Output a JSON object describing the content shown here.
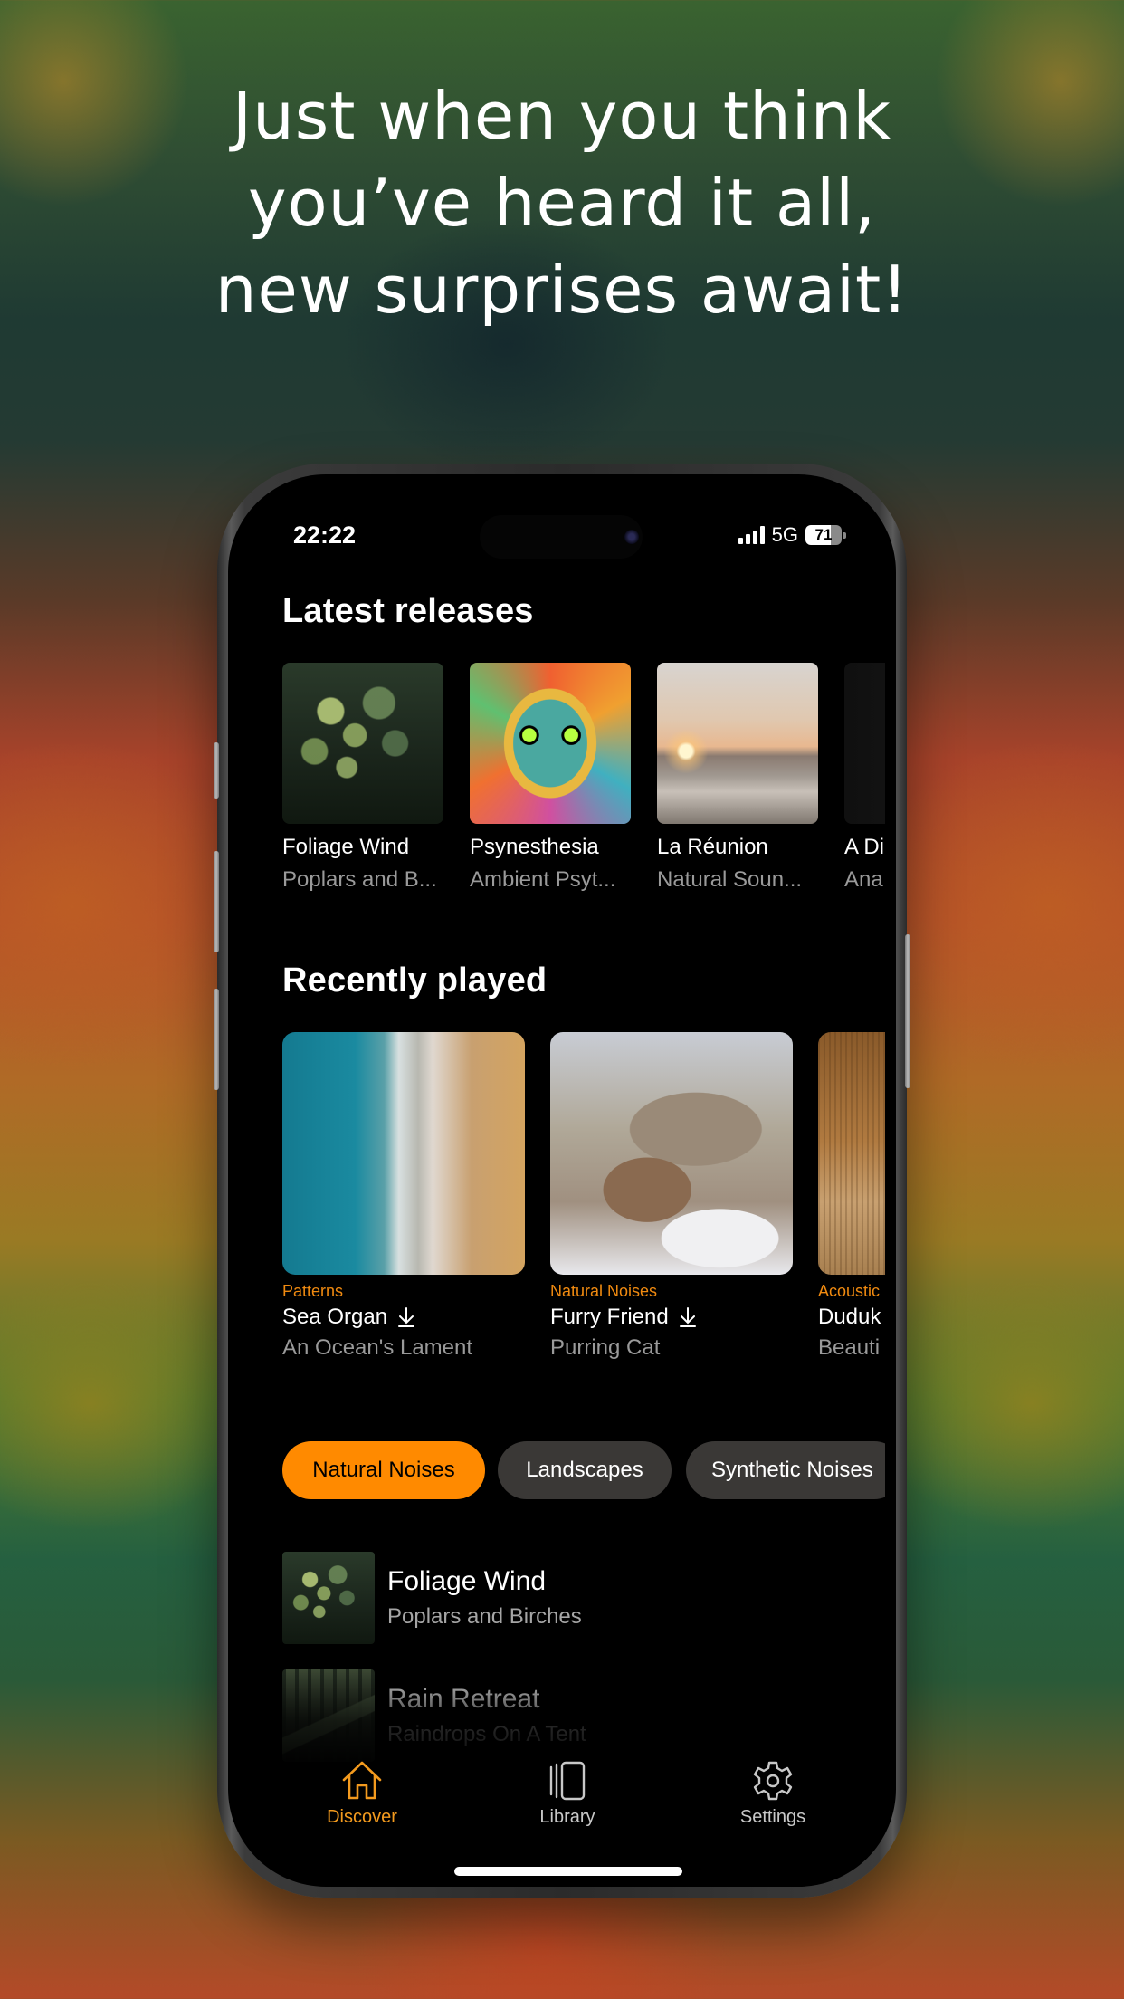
{
  "headline": {
    "lines": [
      "Just when you think",
      "you’ve heard it all,",
      "new surprises await!"
    ]
  },
  "status_bar": {
    "time": "22:22",
    "network": "5G",
    "battery_level": "71",
    "signal_bars": 4
  },
  "latest_releases": {
    "title": "Latest releases",
    "items": [
      {
        "title": "Foliage Wind",
        "subtitle": "Poplars and B...",
        "art": "foliage"
      },
      {
        "title": "Psynesthesia",
        "subtitle": "Ambient Psyt...",
        "art": "psychedelic-cat"
      },
      {
        "title": "La Réunion",
        "subtitle": "Natural Soun...",
        "art": "sunset-beach"
      },
      {
        "title": "A Di",
        "subtitle": "Ana",
        "art": "moon-eclipse"
      }
    ]
  },
  "recently_played": {
    "title": "Recently played",
    "items": [
      {
        "category": "Patterns",
        "title": "Sea Organ",
        "subtitle": "An Ocean's Lament",
        "downloaded": true,
        "art": "aerial-sea"
      },
      {
        "category": "Natural Noises",
        "title": "Furry Friend",
        "subtitle": "Purring Cat",
        "downloaded": true,
        "art": "sleeping-kitten"
      },
      {
        "category": "Acoustic",
        "title": "Duduk",
        "subtitle": "Beauti",
        "downloaded": false,
        "art": "duduk-instrument"
      }
    ]
  },
  "categories": {
    "chips": [
      {
        "label": "Natural Noises",
        "active": true
      },
      {
        "label": "Landscapes",
        "active": false
      },
      {
        "label": "Synthetic Noises",
        "active": false
      }
    ]
  },
  "category_list": {
    "items": [
      {
        "title": "Foliage Wind",
        "subtitle": "Poplars and Birches",
        "art": "foliage"
      },
      {
        "title": "Rain Retreat",
        "subtitle": "Raindrops On A Tent",
        "art": "rain-tent"
      }
    ]
  },
  "tab_bar": {
    "tabs": [
      {
        "label": "Discover",
        "icon": "home-icon",
        "active": true
      },
      {
        "label": "Library",
        "icon": "library-icon",
        "active": false
      },
      {
        "label": "Settings",
        "icon": "gear-icon",
        "active": false
      }
    ]
  },
  "colors": {
    "accent": "#ff8a00",
    "accent_text": "#f39a1e",
    "chip_inactive": "#3a3836",
    "screen_bg": "#000000",
    "secondary_text": "#9a9a9a"
  }
}
